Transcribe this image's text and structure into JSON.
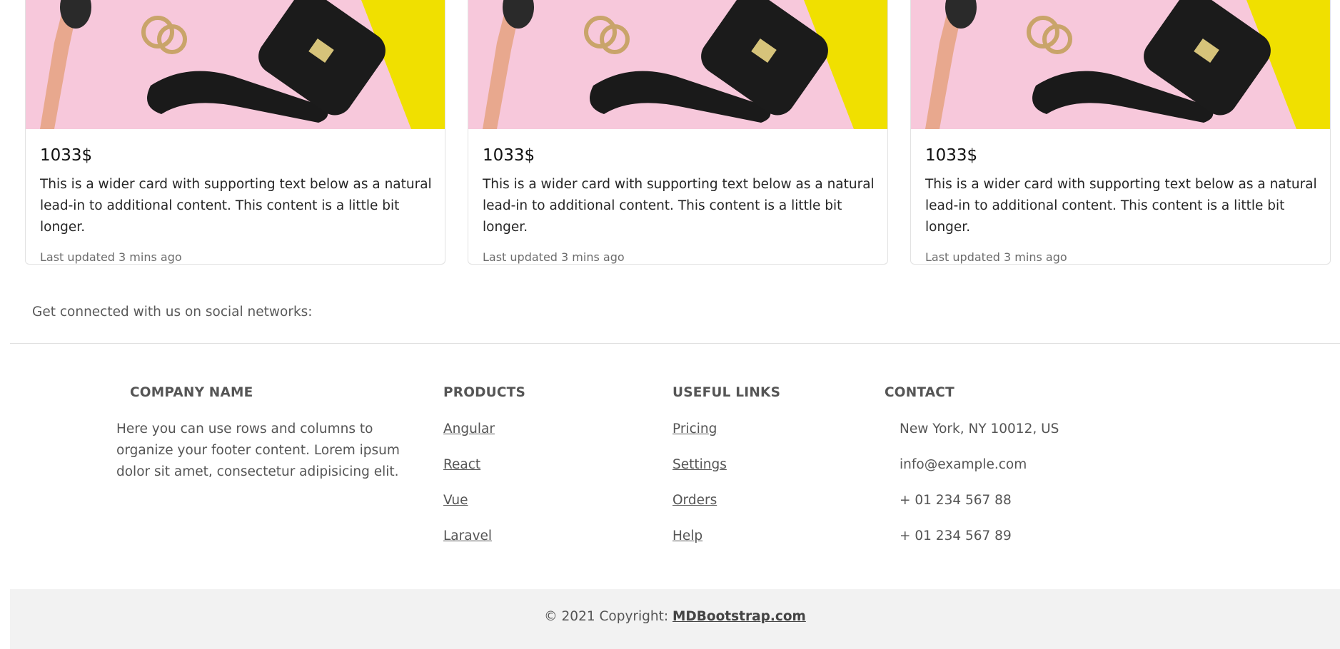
{
  "cards": [
    {
      "title": "1033$",
      "text": "This is a wider card with supporting text below as a natural lead-in to additional content. This content is a little bit longer.",
      "updated": "Last updated 3 mins ago"
    },
    {
      "title": "1033$",
      "text": "This is a wider card with supporting text below as a natural lead-in to additional content. This content is a little bit longer.",
      "updated": "Last updated 3 mins ago"
    },
    {
      "title": "1033$",
      "text": "This is a wider card with supporting text below as a natural lead-in to additional content. This content is a little bit longer.",
      "updated": "Last updated 3 mins ago"
    }
  ],
  "social": {
    "text": "Get connected with us on social networks:"
  },
  "footer": {
    "company": {
      "heading": "COMPANY NAME",
      "description": "Here you can use rows and columns to organize your footer content. Lorem ipsum dolor sit amet, consectetur adipisicing elit."
    },
    "products": {
      "heading": "PRODUCTS",
      "links": [
        "Angular",
        "React",
        "Vue",
        "Laravel"
      ]
    },
    "useful_links": {
      "heading": "USEFUL LINKS",
      "links": [
        "Pricing",
        "Settings",
        "Orders",
        "Help"
      ]
    },
    "contact": {
      "heading": "CONTACT",
      "items": [
        "New York, NY 10012, US",
        "info@example.com",
        "+ 01 234 567 88",
        "+ 01 234 567 89"
      ]
    }
  },
  "copyright": {
    "prefix": "© 2021 Copyright: ",
    "link": "MDBootstrap.com"
  },
  "colors": {
    "card_image_pink": "#f7c8db",
    "card_image_yellow": "#f0e000",
    "copyright_bg": "#f2f2f2"
  }
}
